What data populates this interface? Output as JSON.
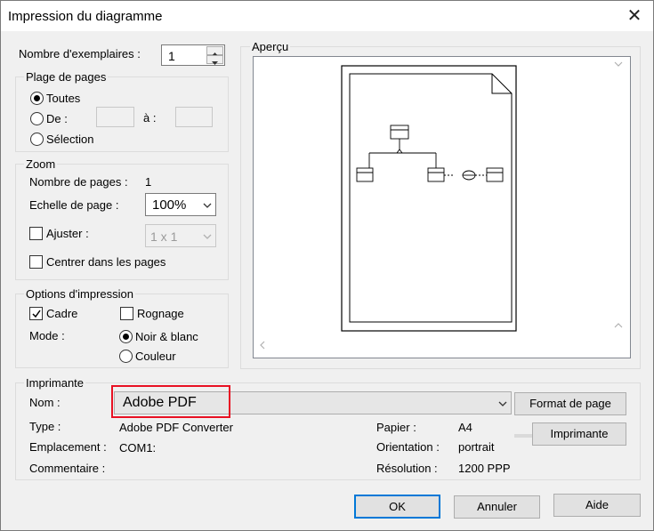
{
  "window": {
    "title": "Impression du diagramme",
    "close_symbol": "✕"
  },
  "copies": {
    "label": "Nombre d'exemplaires :",
    "value": "1"
  },
  "page_range": {
    "legend": "Plage de pages",
    "all_label": "Toutes",
    "from_label": "De :",
    "to_label": "à :",
    "selection_label": "Sélection",
    "selected": "all"
  },
  "zoom": {
    "legend": "Zoom",
    "pages_label": "Nombre de pages :",
    "pages_value": "1",
    "scale_label": "Echelle de page :",
    "scale_value": "100%",
    "fit_label": "Ajuster :",
    "fit_value": "1 x 1",
    "center_label": "Centrer dans les pages"
  },
  "print_options": {
    "legend": "Options d'impression",
    "frame_label": "Cadre",
    "frame_checked": true,
    "crop_label": "Rognage",
    "crop_checked": false,
    "mode_label": "Mode :",
    "bw_label": "Noir & blanc",
    "color_label": "Couleur",
    "selected_mode": "bw"
  },
  "preview": {
    "legend": "Aperçu"
  },
  "printer": {
    "legend": "Imprimante",
    "name_label": "Nom :",
    "name_value": "Adobe PDF",
    "type_label": "Type :",
    "type_value": "Adobe PDF Converter",
    "location_label": "Emplacement :",
    "location_value": "COM1:",
    "comment_label": "Commentaire :",
    "comment_value": "",
    "paper_label": "Papier :",
    "paper_value": "A4",
    "orientation_label": "Orientation :",
    "orientation_value": "portrait",
    "resolution_label": "Résolution :",
    "resolution_value": "1200 PPP",
    "highlight_color": "#e81123"
  },
  "buttons": {
    "page_setup": "Format de page",
    "print": "Imprimante",
    "ok": "OK",
    "cancel": "Annuler",
    "help": "Aide"
  },
  "colors": {
    "default_button_border": "#0078d7",
    "dialog_bg": "#f0f0f0"
  }
}
